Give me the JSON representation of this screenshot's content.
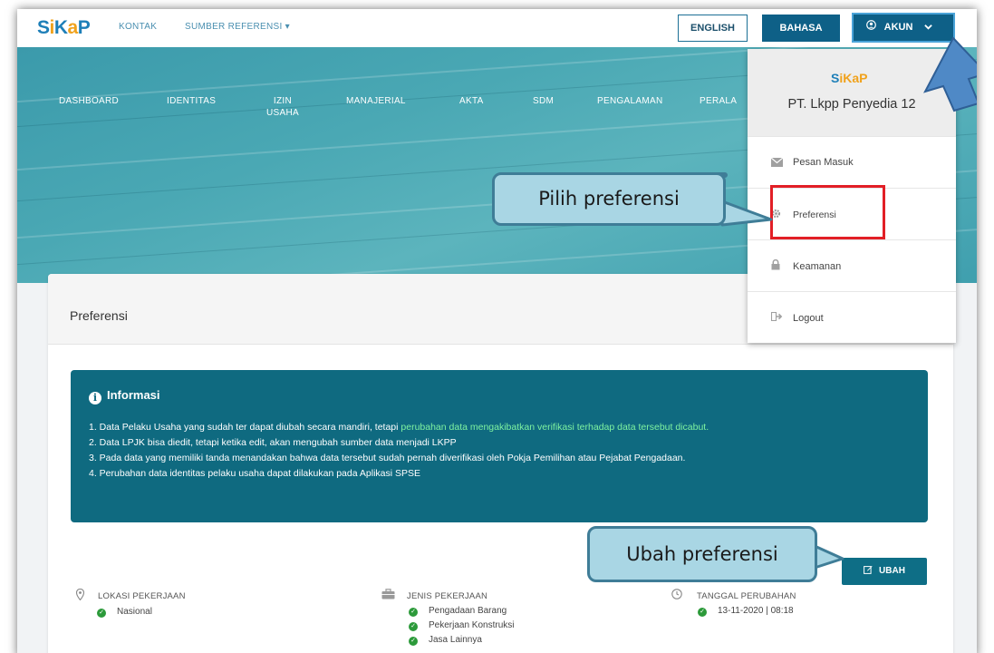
{
  "topbar": {
    "logo": "SiKaP",
    "nav": [
      "KONTAK",
      "SUMBER REFERENSI ▾"
    ],
    "english_label": "ENGLISH",
    "bahasa_label": "BAHASA",
    "akun_label": "AKUN"
  },
  "main_nav": {
    "items": [
      "DASHBOARD",
      "IDENTITAS",
      "IZIN\nUSAHA",
      "MANAJERIAL",
      "AKTA",
      "SDM",
      "PENGALAMAN",
      "PERALA"
    ]
  },
  "card": {
    "title": "Preferensi",
    "info": {
      "title": "Informasi",
      "line1_prefix": "1. Data Pelaku Usaha yang sudah ter dapat diubah secara mandiri, tetapi ",
      "line1_highlight": "perubahan data mengakibatkan verifikasi terhadap data tersebut dicabut.",
      "line2": "2. Data LPJK bisa diedit, tetapi ketika edit, akan mengubah sumber data menjadi LKPP",
      "line3": "3. Pada data yang memiliki tanda menandakan bahwa data tersebut sudah pernah diverifikasi oleh Pokja Pemilihan atau Pejabat Pengadaan.",
      "line4": "4. Perubahan data identitas pelaku usaha dapat dilakukan pada Aplikasi SPSE"
    },
    "ubah_label": "UBAH",
    "columns": {
      "lokasi_title": "LOKASI PEKERJAAN",
      "lokasi_items": [
        "Nasional"
      ],
      "jenis_title": "JENIS PEKERJAAN",
      "jenis_items": [
        "Pengadaan Barang",
        "Pekerjaan Konstruksi",
        "Jasa Lainnya"
      ],
      "tanggal_title": "TANGGAL PERUBAHAN",
      "tanggal_items": [
        "13-11-2020 | 08:18"
      ]
    }
  },
  "dropdown": {
    "logo": "SiKaP",
    "company": "PT. Lkpp Penyedia 12",
    "items": [
      "Pesan Masuk",
      "Preferensi",
      "Keamanan",
      "Logout"
    ]
  },
  "callouts": {
    "pilih": "Pilih preferensi",
    "ubah": "Ubah preferensi"
  },
  "colors": {
    "brand_blue": "#0e6087",
    "info_bg": "#0f6a80",
    "highlight_green": "#7ef2a0",
    "check_green": "#2c9a3a",
    "callout_fill": "#a9d6e4",
    "red_box": "#e21f26"
  },
  "icons": [
    "user-circle-icon",
    "chevron-down-icon",
    "info-circle-icon",
    "envelope-icon",
    "gear-icon",
    "lock-icon",
    "logout-icon",
    "edit-icon",
    "map-marker-icon",
    "briefcase-icon",
    "clock-icon",
    "check-circle-icon",
    "pointer-arrow-icon"
  ]
}
